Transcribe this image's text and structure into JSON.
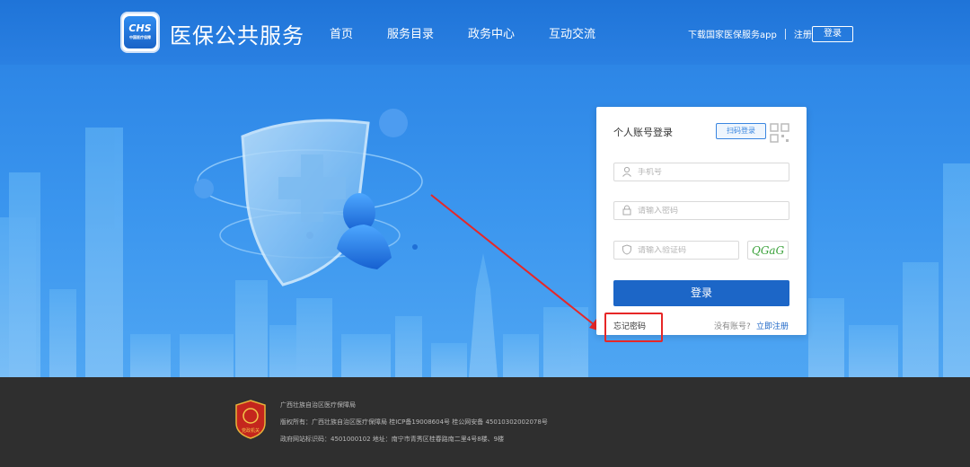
{
  "header": {
    "logo_text": "CHS",
    "logo_sub": "中国医疗保障",
    "site_title": "医保公共服务",
    "nav": [
      "首页",
      "服务目录",
      "政务中心",
      "互动交流"
    ],
    "download_app": "下载国家医保服务app",
    "register": "注册",
    "login": "登录"
  },
  "login_card": {
    "title": "个人账号登录",
    "qr_tab": "扫码登录",
    "phone_placeholder": "手机号",
    "password_placeholder": "请输入密码",
    "captcha_placeholder": "请输入验证码",
    "captcha_text": "QGaG",
    "login_button": "登录",
    "forgot_password": "忘记密码",
    "no_account": "没有账号?",
    "register_now": "立即注册"
  },
  "footer": {
    "org": "广西壮族自治区医疗保障局",
    "copyright": "版权所有：广西壮族自治区医疗保障局 桂ICP备19008604号 桂公网安备 45010302002078号",
    "site_id": "政府网站标识码：4501000102   地址：南宁市青秀区桂春路南二里4号8楼、9楼",
    "emblem_text": "党政机关"
  },
  "colors": {
    "header_blue": "#1f74d8",
    "button_blue": "#1c66c7",
    "highlight_red": "#e62727",
    "footer_bg": "#2f2f2f"
  }
}
